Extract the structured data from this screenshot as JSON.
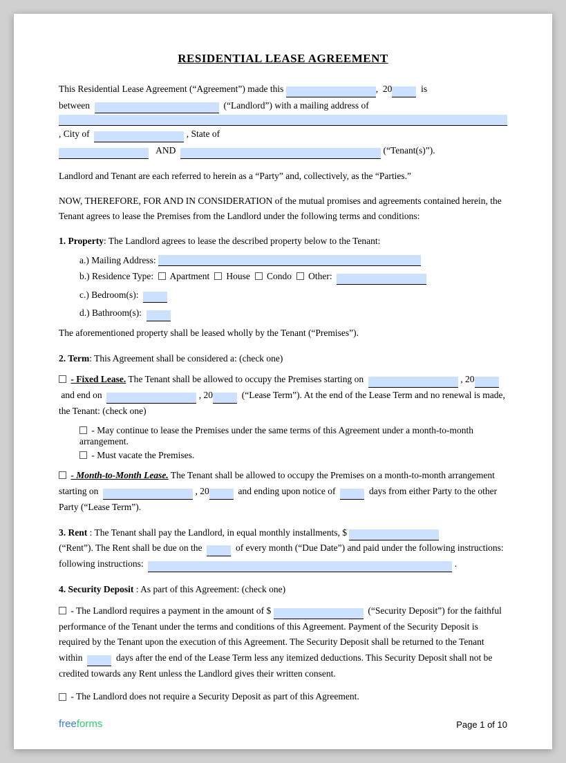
{
  "document": {
    "title": "RESIDENTIAL LEASE AGREEMENT",
    "page_info": "Page 1 of 10",
    "intro": {
      "line1_before": "This Residential Lease Agreement (“Agreement”) made this",
      "line1_mid": ", 20",
      "line1_after": "is",
      "line2_before": "between",
      "line2_mid": "(“Landlord”) with a mailing address of",
      "line3_city_before": ", City of",
      "line3_after": ", State of",
      "line4_and": "AND",
      "line4_after": "(“Tenant(s)”)."
    },
    "parties_text": "Landlord and Tenant are each referred to herein as a “Party” and, collectively, as the “Parties.”",
    "consideration_text": "NOW, THEREFORE, FOR AND IN CONSIDERATION of the mutual promises and agreements contained herein, the Tenant agrees to lease the Premises from the Landlord under the following terms and conditions:",
    "section1": {
      "label": "1. Property",
      "text": ": The Landlord agrees to lease the described property below to the Tenant:",
      "items": {
        "a_label": "a.)  Mailing Address:",
        "b_label": "b.)  Residence Type:",
        "b_apartment": "Apartment",
        "b_house": "House",
        "b_condo": "Condo",
        "b_other_label": "Other:",
        "c_label": "c.)  Bedroom(s):",
        "c_field": "____",
        "d_label": "d.)  Bathroom(s):",
        "d_field": "____"
      },
      "footer_text": "The aforementioned property shall be leased wholly by the Tenant (“Premises”)."
    },
    "section2": {
      "label": "2. Term",
      "text": ": This Agreement shall be considered a: (check one)",
      "fixed_lease_label": "- Fixed Lease.",
      "fixed_lease_text1": " The Tenant shall be allowed to occupy the Premises starting on",
      "fixed_lease_text2": ", 20",
      "fixed_lease_text3": "and end on",
      "fixed_lease_text4": ", 20",
      "fixed_lease_text5": "(“Lease Term”). At the end of the Lease Term and no renewal is made, the Tenant: (check one)",
      "fixed_sub1": "- May continue to lease the Premises under the same terms of this Agreement under a month-to-month arrangement.",
      "fixed_sub2": "- Must vacate the Premises.",
      "monthly_label": "- Month-to-Month Lease.",
      "monthly_text1": " The Tenant shall be allowed to occupy the Premises on a month-to-month arrangement starting on",
      "monthly_text2": ", 20",
      "monthly_text3": "and ending upon notice of",
      "monthly_text4": "days from either Party to the other Party (“Lease Term”)."
    },
    "section3": {
      "label": "3. Rent",
      "text1": ": The Tenant shall pay the Landlord, in equal monthly installments, $",
      "text2": "(“Rent”). The Rent shall be due on the",
      "text3": "of every month (“Due Date”) and paid under the following instructions:",
      "text4": "."
    },
    "section4": {
      "label": "4. Security Deposit",
      "text": ": As part of this Agreement: (check one)",
      "option1_text1": "- The Landlord requires a payment in the amount of $",
      "option1_text2": "(“Security Deposit”) for the faithful performance of the Tenant under the terms and conditions of this Agreement. Payment of the Security Deposit is required by the Tenant upon the execution of this Agreement. The Security Deposit shall be returned to the Tenant within",
      "option1_text3": "days after the end of the Lease Term less any itemized deductions. This Security Deposit shall not be credited towards any Rent unless the Landlord gives their written consent.",
      "option2_text": "- The Landlord does not require a Security Deposit as part of this Agreement."
    }
  },
  "footer": {
    "logo_free": "free",
    "logo_forms": "forms",
    "page_label": "Page 1 of 10"
  }
}
